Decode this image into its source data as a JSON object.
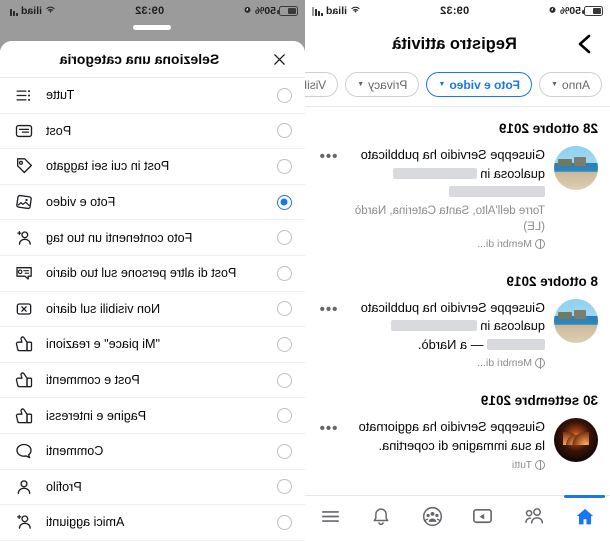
{
  "status_bar": {
    "time": "09:32",
    "battery_percent": "50%",
    "carrier": "iliad",
    "alarm_icon": "alarm-clock-icon",
    "wifi_icon": "wifi-icon",
    "signal_icon": "signal-bars-icon"
  },
  "colors": {
    "accent": "#1877f2",
    "text": "#050505",
    "muted": "#8a8d91",
    "divider": "#e6e8eb",
    "scrim": "#9b9b9b"
  },
  "left_panel": {
    "title": "Registro attività",
    "back_icon": "chevron-back-icon",
    "filters": [
      {
        "label": "Visibilità",
        "active": false
      },
      {
        "label": "Privacy",
        "active": false
      },
      {
        "label": "Foto e video",
        "active": true
      },
      {
        "label": "Anno",
        "active": false
      }
    ],
    "sections": [
      {
        "date": "28 ottobre 2019",
        "entries": [
          {
            "text_before": "Giuseppe Servidio ha pubblicato qualcosa in",
            "redacted": true,
            "subtitle": "Torre dell'Alto, Santa Caterina, Nardò (LE)",
            "audience": "Membri di...",
            "avatar": "seaside-photo-thumbnail",
            "menu_icon": "more-options-icon"
          }
        ]
      },
      {
        "date": "8 ottobre 2019",
        "entries": [
          {
            "text_before": "Giuseppe Servidio ha pubblicato qualcosa in",
            "redacted": true,
            "subtitle": "— a Nardò.",
            "audience": "Membri di...",
            "avatar": "town-photo-thumbnail",
            "menu_icon": "more-options-icon"
          }
        ]
      },
      {
        "date": "30 settembre 2019",
        "entries": [
          {
            "text_before": "Giuseppe Servidio ha aggiornato la sua immagine di copertina.",
            "redacted": false,
            "subtitle": "",
            "audience": "Tutti",
            "avatar": "dark-arches-photo-thumbnail",
            "menu_icon": "more-options-icon"
          }
        ]
      }
    ],
    "tab_bar": [
      {
        "name": "menu-tab",
        "icon": "hamburger-menu-icon",
        "active": false
      },
      {
        "name": "notifications-tab",
        "icon": "bell-icon",
        "active": false
      },
      {
        "name": "groups-tab",
        "icon": "groups-icon",
        "active": false
      },
      {
        "name": "watch-tab",
        "icon": "video-play-icon",
        "active": false
      },
      {
        "name": "friends-tab",
        "icon": "friends-icon",
        "active": false
      },
      {
        "name": "home-tab",
        "icon": "home-icon",
        "active": true
      }
    ]
  },
  "right_panel": {
    "sheet_title": "Seleziona una categoria",
    "close_icon": "close-icon",
    "options": [
      {
        "label": "Tutte",
        "icon": "list-icon",
        "selected": false
      },
      {
        "label": "Post",
        "icon": "post-card-icon",
        "selected": false
      },
      {
        "label": "Post in cui sei taggato",
        "icon": "tag-icon",
        "selected": false
      },
      {
        "label": "Foto e video",
        "icon": "photo-icon",
        "selected": true
      },
      {
        "label": "Foto contenenti un tuo tag",
        "icon": "person-tag-icon",
        "selected": false
      },
      {
        "label": "Post di altre persone sul tuo diario",
        "icon": "comment-card-icon",
        "selected": false
      },
      {
        "label": "Non visibili sul diario",
        "icon": "hidden-x-icon",
        "selected": false
      },
      {
        "label": "\"Mi piace\" e reazioni",
        "icon": "thumbs-up-icon",
        "selected": false
      },
      {
        "label": "Post e commenti",
        "icon": "thumbs-up-icon",
        "selected": false
      },
      {
        "label": "Pagine e interessi",
        "icon": "thumbs-up-icon",
        "selected": false
      },
      {
        "label": "Commenti",
        "icon": "speech-bubble-icon",
        "selected": false
      },
      {
        "label": "Profilo",
        "icon": "person-icon",
        "selected": false
      },
      {
        "label": "Amici aggiunti",
        "icon": "person-add-icon",
        "selected": false
      }
    ]
  }
}
